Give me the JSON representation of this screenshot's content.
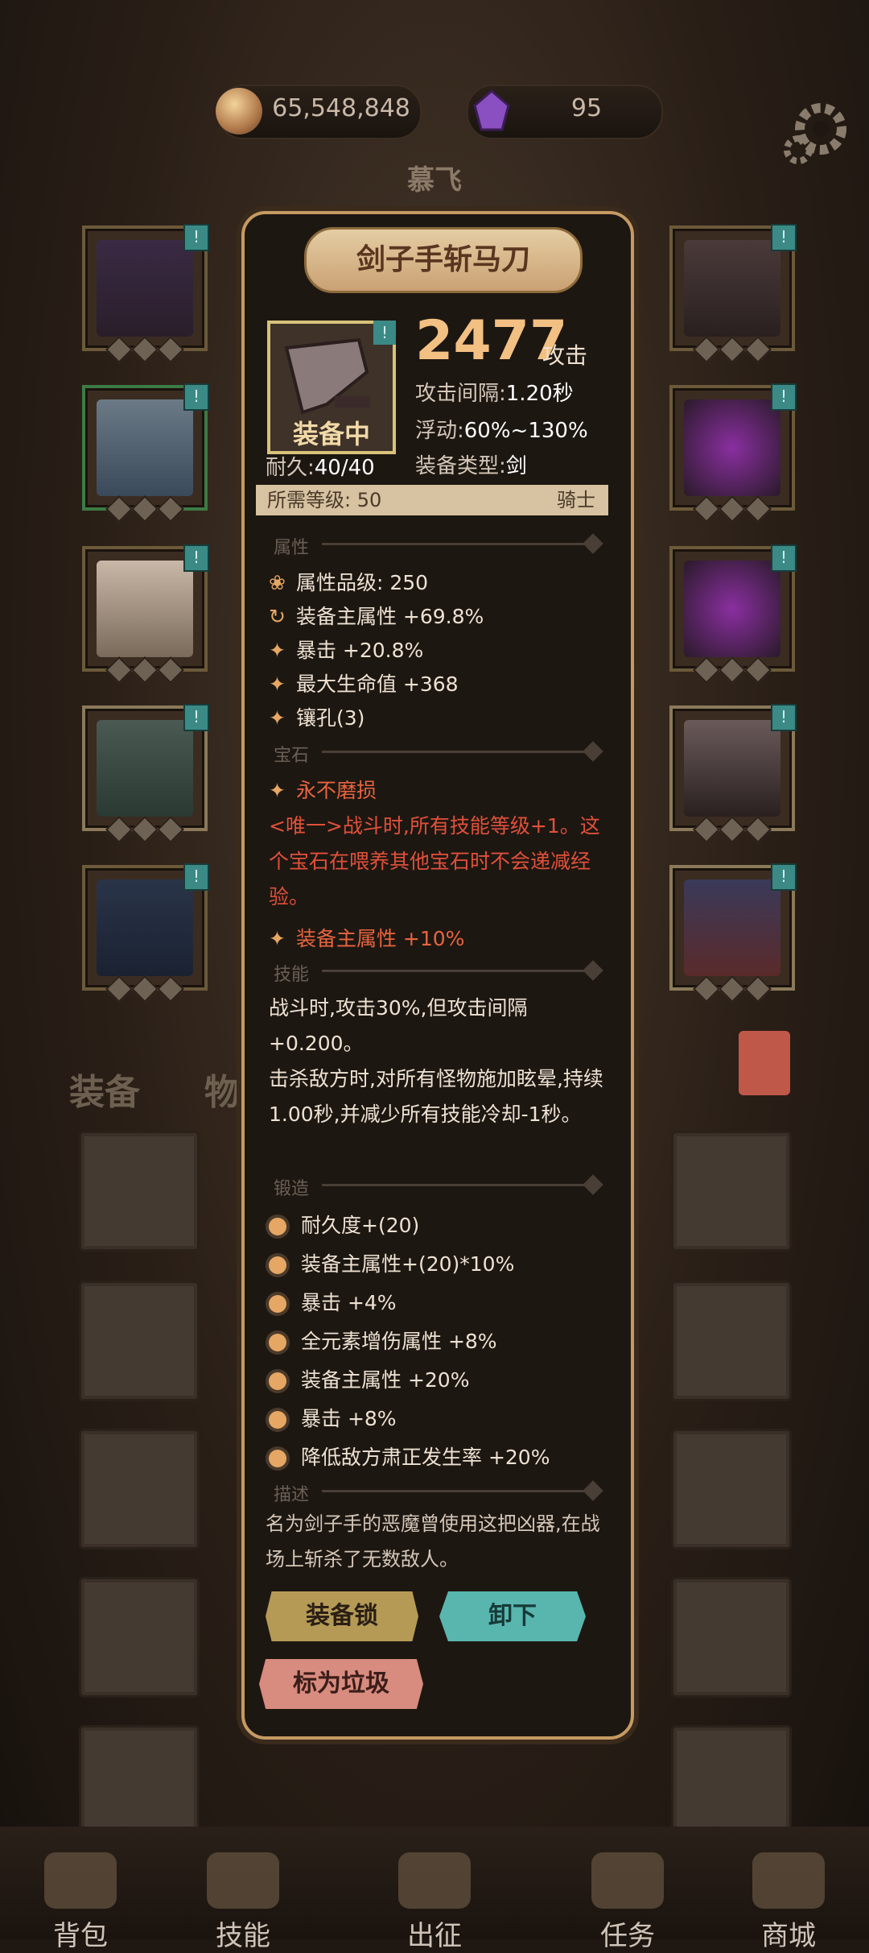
{
  "resources": {
    "gold": "65,548,848",
    "gems": "95"
  },
  "hero_name": "慕飞",
  "tabs": {
    "equipment": "装备",
    "items": "物品"
  },
  "item": {
    "name": "剑子手斩马刀",
    "status": "装备中",
    "durability_label": "耐久:",
    "durability": "40/40",
    "attack_value": "2477",
    "attack_label": "攻击",
    "interval_label": "攻击间隔:",
    "interval": "1.20秒",
    "float_label": "浮动:",
    "float": "60%~130%",
    "type_label": "装备类型:",
    "type": "剑",
    "req_label": "所需等级:",
    "req_level": "50",
    "class": "骑士"
  },
  "sections": {
    "attributes": "属性",
    "gems": "宝石",
    "skills": "技能",
    "forge": "锻造",
    "description": "描述"
  },
  "attributes": [
    {
      "text": "属性品级: 250"
    },
    {
      "text": "装备主属性 +69.8%"
    },
    {
      "text": "暴击 +20.8%"
    },
    {
      "text": "最大生命值 +368"
    },
    {
      "text": "镶孔(3)"
    }
  ],
  "gem": {
    "name": "永不磨损",
    "desc": "<唯一>战斗时,所有技能等级+1。这个宝石在喂养其他宝石时不会递减经验。",
    "bonus": "装备主属性 +10%"
  },
  "skills": [
    "战斗时,攻击30%,但攻击间隔+0.200。",
    "击杀敌方时,对所有怪物施加眩晕,持续1.00秒,并减少所有技能冷却-1秒。"
  ],
  "forge": [
    "耐久度+(20)",
    "装备主属性+(20)*10%",
    "暴击 +4%",
    "全元素增伤属性 +8%",
    "装备主属性 +20%",
    "暴击 +8%",
    "降低敌方肃正发生率 +20%"
  ],
  "description": "名为剑子手的恶魔曾使用这把凶器,在战场上斩杀了无数敌人。",
  "buttons": {
    "lock": "装备锁",
    "unequip": "卸下",
    "junk": "标为垃圾"
  },
  "slot_tag": "!",
  "nav": [
    "背包",
    "技能",
    "出征",
    "任务",
    "商城"
  ],
  "colors": {
    "accent": "#f2c083",
    "gem_red": "#e7643f",
    "unequip": "#58b6ae",
    "lock": "#b59a56",
    "junk": "#d88b7f"
  }
}
